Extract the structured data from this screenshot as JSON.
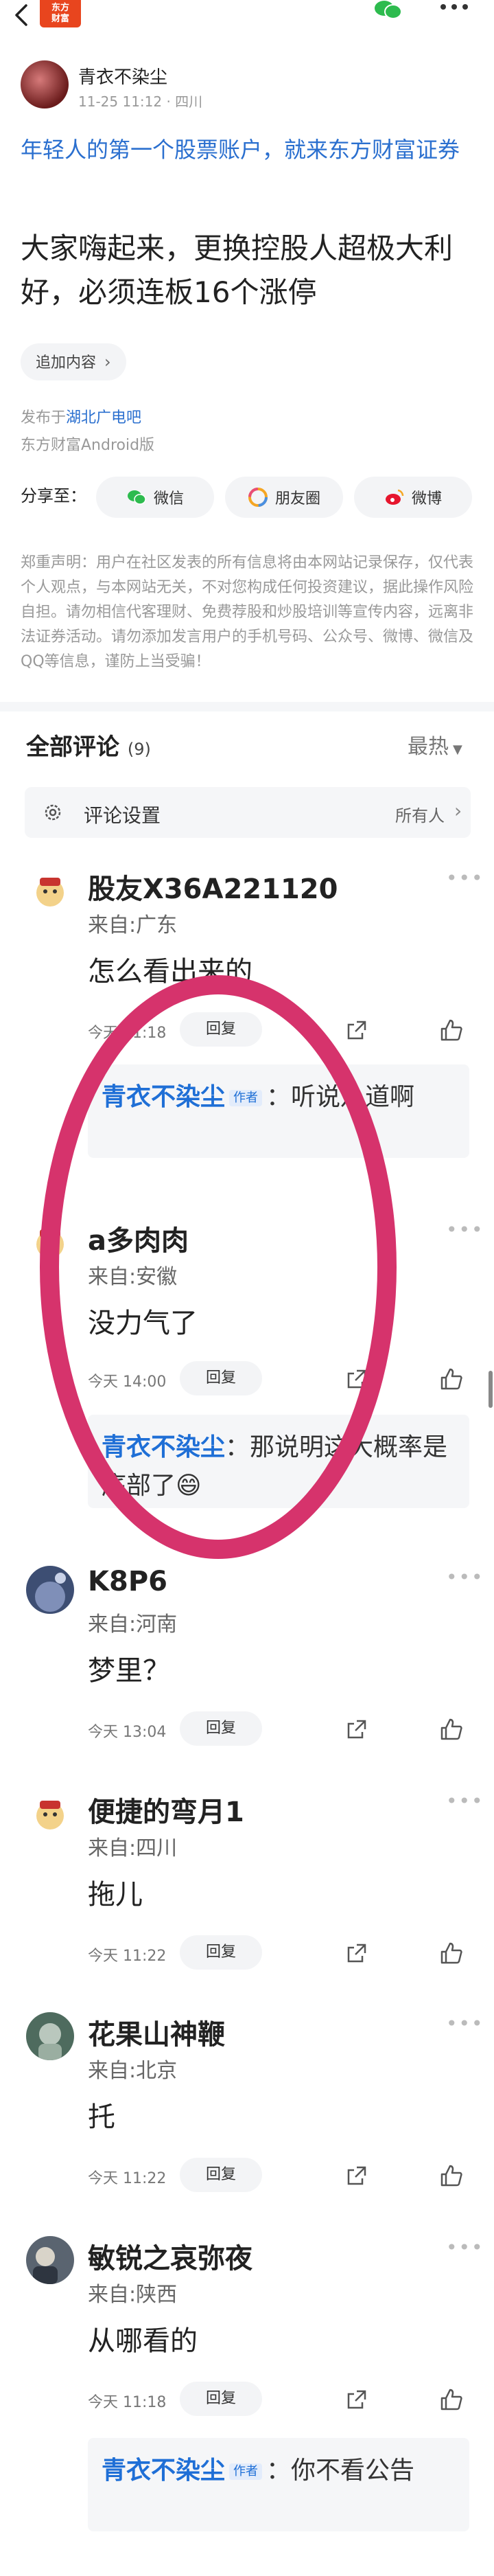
{
  "nav": {
    "logo_line1": "东方",
    "logo_line2": "财富"
  },
  "author": {
    "name": "青衣不染尘",
    "meta": "11-25 11:12 · 四川"
  },
  "promo": "年轻人的第一个股票账户，就来东方财富证券",
  "title": "大家嗨起来，更换控股人超极大利好，必须连板16个涨停",
  "add_content": "追加内容",
  "published": {
    "prefix": "发布于",
    "bar": "湖北广电吧"
  },
  "client": "东方财富Android版",
  "share": {
    "label": "分享至：",
    "wechat": "微信",
    "moments": "朋友圈",
    "weibo": "微博"
  },
  "disclaimer": "郑重声明：用户在社区发表的所有信息将由本网站记录保存，仅代表个人观点，与本网站无关，不对您构成任何投资建议，据此操作风险自担。请勿相信代客理财、免费荐股和炒股培训等宣传内容，远离非法证券活动。请勿添加发言用户的手机号码、公众号、微博、微信及QQ等信息，谨防上当受骗！",
  "comments_header": {
    "title": "全部评论",
    "count": "(9)",
    "sort": "最热"
  },
  "settings": {
    "label": "评论设置",
    "value": "所有人"
  },
  "reply_label": "回复",
  "comments": [
    {
      "name": "股友X36A221120",
      "loc": "来自:广东",
      "text": "怎么看出来的",
      "time": "今天 11:18",
      "reply": {
        "name": "青衣不染尘",
        "tag": "作者",
        "text": "：听说八道啊"
      }
    },
    {
      "name": "a多肉肉",
      "loc": "来自:安徽",
      "text": "没力气了",
      "time": "今天 14:00",
      "reply": {
        "name": "青衣不染尘",
        "tag": "",
        "text": "：那说明这大概率是底部了😄"
      }
    },
    {
      "name": "K8P6",
      "loc": "来自:河南",
      "text": "梦里？",
      "time": "今天 13:04"
    },
    {
      "name": "便捷的弯月1",
      "loc": "来自:四川",
      "text": "拖儿",
      "time": "今天 11:22"
    },
    {
      "name": "花果山神鞭",
      "loc": "来自:北京",
      "text": "托",
      "time": "今天 11:22"
    },
    {
      "name": "敏锐之哀弥夜",
      "loc": "来自:陕西",
      "text": "从哪看的",
      "time": "今天 11:18",
      "reply": {
        "name": "青衣不染尘",
        "tag": "作者",
        "text": "：你不看公告"
      }
    }
  ],
  "colors": {
    "accent": "#2a6fcf",
    "highlight_circle": "#d6336c",
    "brand": "#e8451e"
  }
}
